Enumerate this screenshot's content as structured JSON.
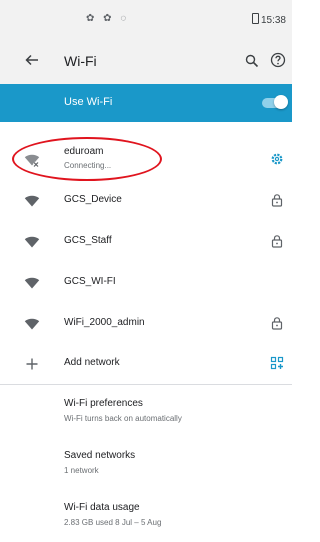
{
  "status_bar": {
    "time": "15:38",
    "left_icons": "✿ ✿ ◌"
  },
  "header": {
    "title": "Wi-Fi"
  },
  "use_wifi": {
    "label": "Use Wi-Fi",
    "enabled": true
  },
  "networks": [
    {
      "name": "eduroam",
      "status": "Connecting...",
      "right_icon": "gear-icon"
    },
    {
      "name": "GCS_Device",
      "right_icon": "lock-icon"
    },
    {
      "name": "GCS_Staff",
      "right_icon": "lock-icon"
    },
    {
      "name": "GCS_WI-FI",
      "right_icon": ""
    },
    {
      "name": "WiFi_2000_admin",
      "right_icon": "lock-icon"
    }
  ],
  "add_network": {
    "label": "Add network"
  },
  "preferences": {
    "wifi_preferences": {
      "title": "Wi-Fi preferences",
      "subtitle": "Wi-Fi turns back on automatically"
    },
    "saved_networks": {
      "title": "Saved networks",
      "subtitle": "1 network"
    },
    "data_usage": {
      "title": "Wi-Fi data usage",
      "subtitle": "2.83 GB used 8 Jul – 5 Aug"
    }
  },
  "colors": {
    "accent": "#1a98c9",
    "annotation": "#e0141e",
    "gear": "#1a98c9"
  }
}
